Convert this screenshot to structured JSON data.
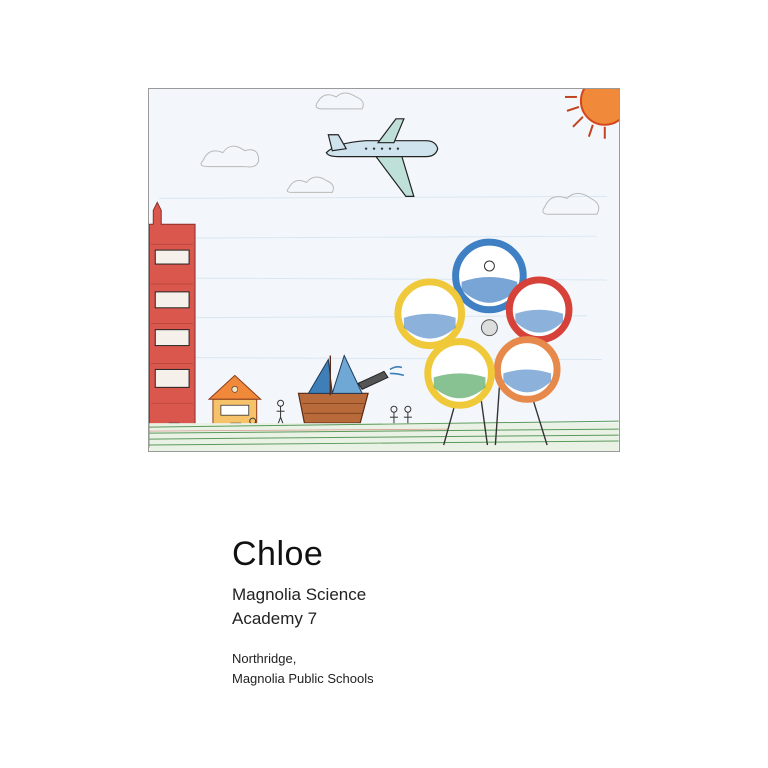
{
  "artwork": {
    "kind": "child-crayon-drawing"
  },
  "student": {
    "name": "Chloe"
  },
  "school": {
    "line1": "Magnolia Science",
    "line2": "Academy 7"
  },
  "location": {
    "line1": "Northridge,",
    "line2": "Magnolia Public Schools"
  },
  "colors": {
    "sky": "#e8f1f8",
    "grass": "#5a9a5a",
    "building": "#c8473e",
    "ring_blue": "#3f7fc4",
    "ring_red": "#d6423a",
    "ring_yellow": "#f0c93a",
    "ring_orange": "#e6894a",
    "sun": "#e65a2a"
  }
}
